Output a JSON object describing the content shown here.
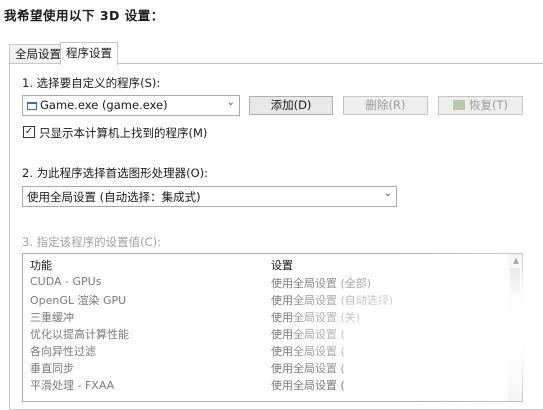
{
  "heading": "我希望使用以下 3D 设置：",
  "tabs": [
    {
      "label": "全局设置"
    },
    {
      "label": "程序设置"
    }
  ],
  "section1": {
    "label": "1. 选择要自定义的程序(S):",
    "program_combo_value": "Game.exe (game.exe)",
    "add_button": "添加(D)",
    "remove_button": "删除(R)",
    "restore_button": "恢复(T)",
    "show_only_found_checkbox": "只显示本计算机上找到的程序(M)",
    "show_only_found_checked": true
  },
  "section2": {
    "label": "2. 为此程序选择首选图形处理器(O):",
    "gpu_combo_value": "使用全局设置 (自动选择：集成式)"
  },
  "section3": {
    "label": "3. 指定该程序的设置值(C):",
    "columns": [
      "功能",
      "设置"
    ],
    "rows": [
      {
        "feature": "CUDA - GPUs",
        "setting": "使用全局设置 (全部)"
      },
      {
        "feature": "OpenGL 渲染 GPU",
        "setting": "使用全局设置 (自动选择)"
      },
      {
        "feature": "三重缓冲",
        "setting": "使用全局设置 (关)"
      },
      {
        "feature": "优化以提高计算性能",
        "setting": "使用全局设置 ("
      },
      {
        "feature": "各向异性过滤",
        "setting": "使用全局设置 ("
      },
      {
        "feature": "垂直同步",
        "setting": "使用全局设置 ("
      },
      {
        "feature": "平滑处理 - FXAA",
        "setting": "使用全局设置 ("
      }
    ]
  },
  "icons": {
    "program": "app-window-icon",
    "restore": "nvidia-logo-icon",
    "combo": "chevron-down-icon",
    "check": "checkmark-icon",
    "scroll": "scroll-up-arrow-icon"
  }
}
